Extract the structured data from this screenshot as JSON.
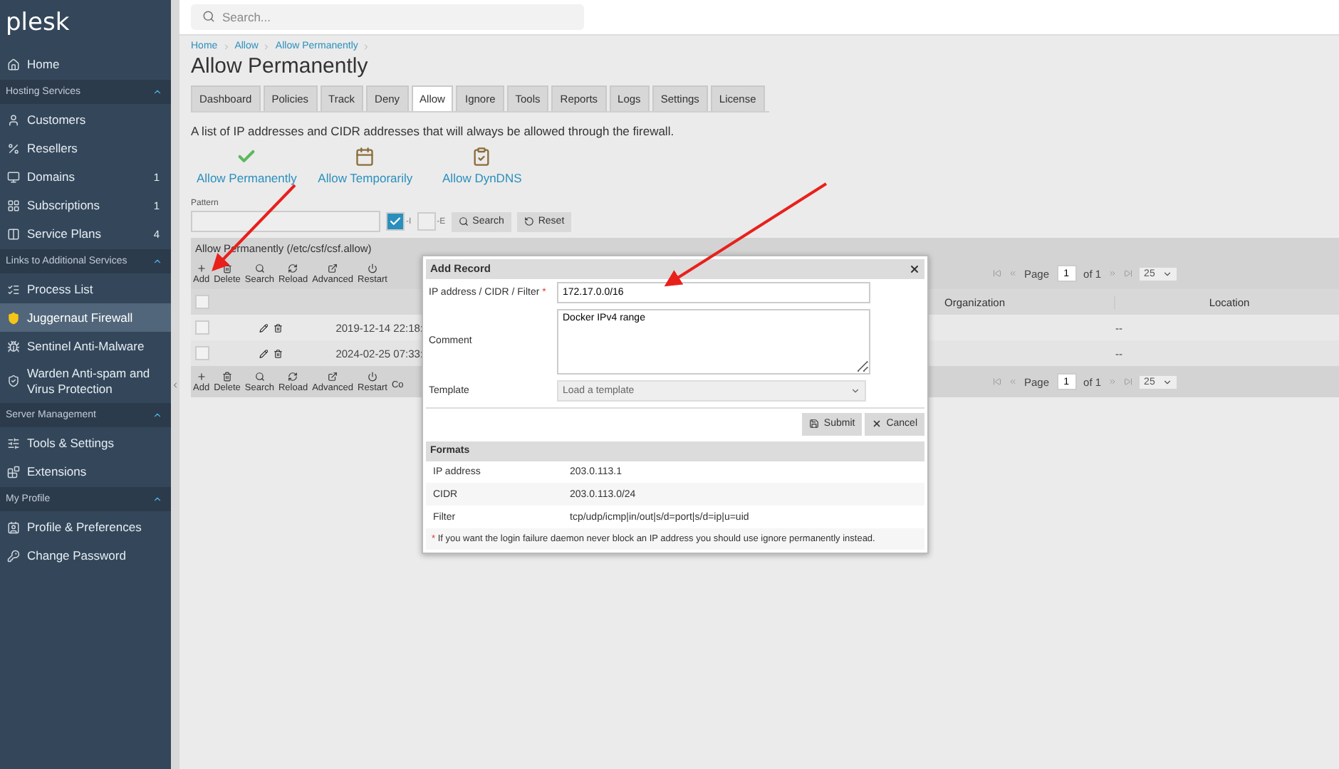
{
  "sidebar": {
    "logo": "plesk",
    "items": [
      {
        "kind": "link",
        "label": "Home",
        "selected": false
      },
      {
        "kind": "section",
        "label": "Hosting Services",
        "expanded": true
      },
      {
        "kind": "link",
        "label": "Customers",
        "selected": false
      },
      {
        "kind": "link",
        "label": "Resellers",
        "selected": false
      },
      {
        "kind": "link",
        "label": "Domains",
        "count": "1",
        "selected": false
      },
      {
        "kind": "link",
        "label": "Subscriptions",
        "count": "1",
        "selected": false
      },
      {
        "kind": "link",
        "label": "Service Plans",
        "count": "4",
        "selected": false
      },
      {
        "kind": "section",
        "label": "Links to Additional Services",
        "expanded": true
      },
      {
        "kind": "link",
        "label": "Process List",
        "selected": false
      },
      {
        "kind": "link",
        "label": "Juggernaut Firewall",
        "selected": true
      },
      {
        "kind": "link",
        "label": "Sentinel Anti-Malware",
        "selected": false
      },
      {
        "kind": "link",
        "label": "Warden Anti-spam and Virus Protection",
        "selected": false
      },
      {
        "kind": "section",
        "label": "Server Management",
        "expanded": true
      },
      {
        "kind": "link",
        "label": "Tools & Settings",
        "selected": false
      },
      {
        "kind": "link",
        "label": "Extensions",
        "selected": false
      },
      {
        "kind": "section",
        "label": "My Profile",
        "expanded": true
      },
      {
        "kind": "link",
        "label": "Profile & Preferences",
        "selected": false
      },
      {
        "kind": "link",
        "label": "Change Password",
        "selected": false
      }
    ]
  },
  "search": {
    "placeholder": "Search..."
  },
  "breadcrumbs": [
    "Home",
    "Allow",
    "Allow Permanently"
  ],
  "title": "Allow Permanently",
  "tabs": [
    {
      "label": "Dashboard",
      "selected": false
    },
    {
      "label": "Policies",
      "selected": false
    },
    {
      "label": "Track",
      "selected": false
    },
    {
      "label": "Deny",
      "selected": false
    },
    {
      "label": "Allow",
      "selected": true
    },
    {
      "label": "Ignore",
      "selected": false
    },
    {
      "label": "Tools",
      "selected": false
    },
    {
      "label": "Reports",
      "selected": false
    },
    {
      "label": "Logs",
      "selected": false
    },
    {
      "label": "Settings",
      "selected": false
    },
    {
      "label": "License",
      "selected": false
    }
  ],
  "description": "A list of IP addresses and CIDR addresses that will always be allowed through the firewall.",
  "actions": [
    "Allow Permanently",
    "Allow Temporarily",
    "Allow DynDNS"
  ],
  "filter": {
    "label": "Pattern",
    "options": [
      {
        "label": "-I",
        "checked": true
      },
      {
        "label": "-E",
        "checked": false
      }
    ],
    "buttons": [
      "Search",
      "Reset"
    ]
  },
  "table": {
    "title": "Allow Permanently (/etc/csf/csf.allow)",
    "toolbar": [
      "Add",
      "Delete",
      "Search",
      "Reload",
      "Advanced",
      "Restart"
    ],
    "bottom_toolbar": [
      "Add",
      "Delete",
      "Search",
      "Reload",
      "Advanced",
      "Restart",
      "Co"
    ],
    "pager": {
      "label": "Page",
      "page": "1",
      "of": "of 1",
      "per_page": "25"
    },
    "bottom_pager": {
      "label": "Page",
      "page": "1",
      "of": "of 1",
      "per_page": "25"
    },
    "select_all": {
      "checked": false
    },
    "columns": [
      "Organization",
      "Location"
    ],
    "rows": [
      {
        "checked": false,
        "date": "2019-12-14 22:18:",
        "value": "--"
      },
      {
        "checked": false,
        "date": "2024-02-25 07:33:",
        "value": "--"
      }
    ]
  },
  "dialog": {
    "title": "Add Record",
    "fields": [
      {
        "kind": "input",
        "label": "IP address / CIDR / Filter",
        "required": true,
        "value": "172.17.0.0/16"
      },
      {
        "kind": "textarea",
        "label": "Comment",
        "required": false,
        "value": "Docker IPv4 range"
      },
      {
        "kind": "select",
        "label": "Template",
        "required": false,
        "value": "Load a template"
      }
    ],
    "buttons": [
      "Submit",
      "Cancel"
    ],
    "formats_title": "Formats",
    "formats": [
      {
        "name": "IP address",
        "example": "203.0.113.1"
      },
      {
        "name": "CIDR",
        "example": "203.0.113.0/24"
      },
      {
        "name": "Filter",
        "example": "tcp/udp/icmp|in/out|s/d=port|s/d=ip|u=uid"
      }
    ],
    "note_mark": "*",
    "note": "If you want the login failure daemon never block an IP address you should use ignore permanently instead."
  }
}
